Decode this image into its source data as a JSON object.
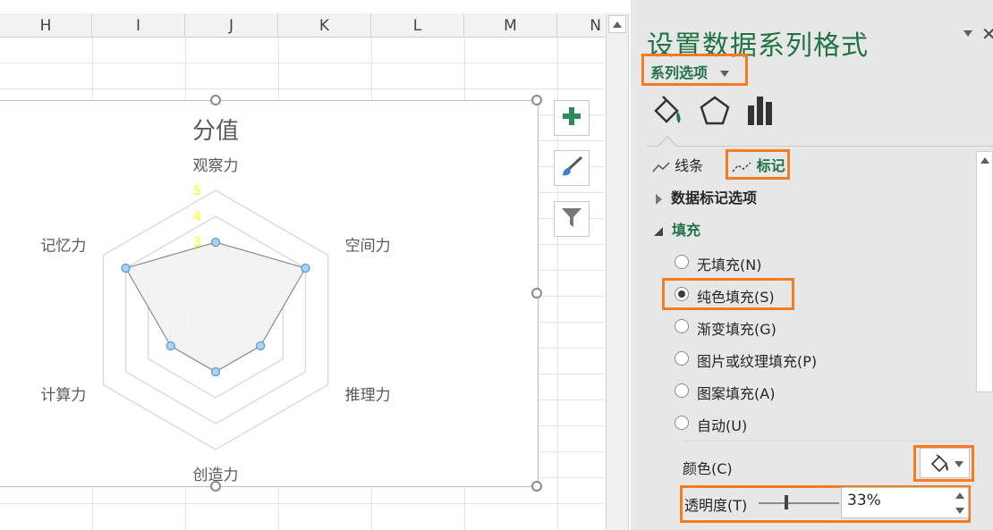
{
  "sheet": {
    "columns": [
      "H",
      "I",
      "J",
      "K",
      "L",
      "M",
      "N"
    ]
  },
  "chart_data": {
    "type": "radar",
    "title": "分值",
    "categories": [
      "观察力",
      "空间力",
      "推理力",
      "创造力",
      "计算力",
      "记忆力"
    ],
    "series": [
      {
        "values": [
          3,
          4,
          2,
          2,
          2,
          4
        ]
      }
    ],
    "axis_ticks": [
      "0",
      "1",
      "2",
      "3",
      "4",
      "5"
    ],
    "rlim": [
      0,
      5
    ],
    "grid": true,
    "colors": {
      "series_line": "#8c8c8c",
      "series_fill": "#f2f2f2",
      "marker_fill": "#a9d3f5",
      "marker_stroke": "#5b9bd5",
      "tick_labels": "#ffff00",
      "grid": "#d9d9d9"
    }
  },
  "chart_buttons": {
    "add_icon": "plus-icon",
    "style_icon": "brush-icon",
    "filter_icon": "funnel-icon"
  },
  "pane": {
    "title": "设置数据系列格式",
    "series_options_label": "系列选项",
    "tabs_icons": [
      "fill-line-icon",
      "effects-pentagon-icon",
      "series-options-bars-icon"
    ],
    "subtab_line": "线条",
    "subtab_marker": "标记",
    "marker_options_label": "数据标记选项",
    "fill_label": "填充",
    "fill_options": [
      {
        "label": "无填充(N)",
        "selected": false
      },
      {
        "label": "纯色填充(S)",
        "selected": true
      },
      {
        "label": "渐变填充(G)",
        "selected": false
      },
      {
        "label": "图片或纹理填充(P)",
        "selected": false
      },
      {
        "label": "图案填充(A)",
        "selected": false
      },
      {
        "label": "自动(U)",
        "selected": false
      }
    ],
    "color_label": "颜色(C)",
    "transparency_label": "透明度(T)",
    "transparency_value": "33%",
    "accent": "#217346",
    "highlight": "#f47b20"
  }
}
